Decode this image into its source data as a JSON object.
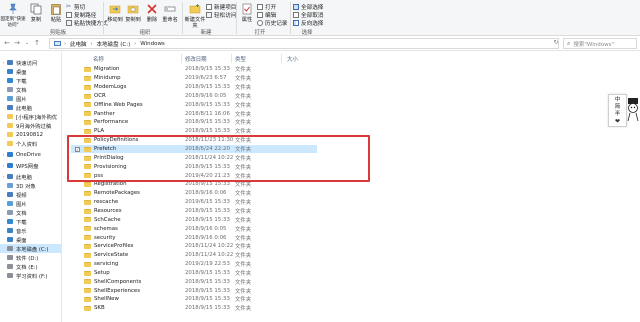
{
  "ribbon": {
    "clipboard": {
      "pin_label": "固定到\"快速访问\"",
      "copy_label": "复制",
      "paste_label": "粘贴",
      "cut_label": "剪切",
      "copy_path_label": "复制路径",
      "paste_shortcut_label": "粘贴快捷方式",
      "group_label": "剪贴板"
    },
    "organize": {
      "move_to_label": "移动到",
      "copy_to_label": "复制到",
      "delete_label": "删除",
      "rename_label": "重命名",
      "group_label": "组织"
    },
    "new": {
      "new_folder_label": "新建文件夹",
      "new_item_label": "新建项目",
      "easy_access_label": "轻松访问",
      "group_label": "新建"
    },
    "open": {
      "properties_label": "属性",
      "open_label": "打开",
      "edit_label": "编辑",
      "history_label": "历史记录",
      "group_label": "打开"
    },
    "select": {
      "select_all_label": "全部选择",
      "select_none_label": "全部取消",
      "invert_label": "反向选择",
      "group_label": "选择"
    }
  },
  "address": {
    "crumbs": [
      "此电脑",
      "本地磁盘 (C:)",
      "Windows"
    ],
    "search_placeholder": "搜索\"Windows\""
  },
  "columns": {
    "name": "名称",
    "date": "修改日期",
    "type": "类型",
    "size": "大小"
  },
  "nav": [
    {
      "label": "快速访问",
      "icon": "star-icon",
      "level": 0
    },
    {
      "label": "桌面",
      "icon": "desktop-icon",
      "level": 1
    },
    {
      "label": "下载",
      "icon": "download-icon",
      "level": 1
    },
    {
      "label": "文档",
      "icon": "document-icon",
      "level": 1
    },
    {
      "label": "图片",
      "icon": "picture-icon",
      "level": 1
    },
    {
      "label": "此电脑",
      "icon": "computer-icon",
      "level": 1
    },
    {
      "label": "[小程序]海外购优",
      "icon": "folder-icon",
      "level": 1
    },
    {
      "label": "9月海外购过稿",
      "icon": "folder-icon",
      "level": 1
    },
    {
      "label": "20190812",
      "icon": "folder-icon",
      "level": 1
    },
    {
      "label": "个人资料",
      "icon": "folder-icon",
      "level": 1
    },
    {
      "label": "OneDrive",
      "icon": "cloud-icon",
      "level": 0
    },
    {
      "label": "WPS网盘",
      "icon": "cloud-icon",
      "level": 0
    },
    {
      "label": "此电脑",
      "icon": "computer-icon",
      "level": 0
    },
    {
      "label": "3D 对象",
      "icon": "cube-icon",
      "level": 1
    },
    {
      "label": "视频",
      "icon": "video-icon",
      "level": 1
    },
    {
      "label": "图片",
      "icon": "picture-icon",
      "level": 1
    },
    {
      "label": "文档",
      "icon": "document-icon",
      "level": 1
    },
    {
      "label": "下载",
      "icon": "download-icon",
      "level": 1
    },
    {
      "label": "音乐",
      "icon": "music-icon",
      "level": 1
    },
    {
      "label": "桌面",
      "icon": "desktop-icon",
      "level": 1
    },
    {
      "label": "本地磁盘 (C:)",
      "icon": "drive-icon",
      "level": 1,
      "selected": true
    },
    {
      "label": "软件 (D:)",
      "icon": "drive-icon",
      "level": 1
    },
    {
      "label": "文档 (E:)",
      "icon": "drive-icon",
      "level": 1
    },
    {
      "label": "学习资料 (F:)",
      "icon": "drive-icon",
      "level": 1
    }
  ],
  "files": [
    {
      "name": "Migration",
      "date": "2018/9/15 15:33",
      "type": "文件夹"
    },
    {
      "name": "Minidump",
      "date": "2019/6/23 6:57",
      "type": "文件夹"
    },
    {
      "name": "ModemLogs",
      "date": "2018/9/15 15:33",
      "type": "文件夹"
    },
    {
      "name": "OCR",
      "date": "2018/9/16 0:05",
      "type": "文件夹"
    },
    {
      "name": "Offline Web Pages",
      "date": "2018/9/15 15:33",
      "type": "文件夹"
    },
    {
      "name": "Panther",
      "date": "2018/8/11 16:06",
      "type": "文件夹"
    },
    {
      "name": "Performance",
      "date": "2018/9/15 15:33",
      "type": "文件夹"
    },
    {
      "name": "PLA",
      "date": "2018/9/15 15:33",
      "type": "文件夹"
    },
    {
      "name": "PolicyDefinitions",
      "date": "2018/11/23 11:30",
      "type": "文件夹"
    },
    {
      "name": "Prefetch",
      "date": "2018/6/24 22:20",
      "type": "文件夹",
      "selected": true
    },
    {
      "name": "PrintDialog",
      "date": "2018/11/24 10:22",
      "type": "文件夹"
    },
    {
      "name": "Provisioning",
      "date": "2018/9/15 15:33",
      "type": "文件夹"
    },
    {
      "name": "pss",
      "date": "2019/4/20 21:23",
      "type": "文件夹"
    },
    {
      "name": "Registration",
      "date": "2018/9/15 15:33",
      "type": "文件夹"
    },
    {
      "name": "RemotePackages",
      "date": "2018/9/16 0:06",
      "type": "文件夹"
    },
    {
      "name": "rescache",
      "date": "2019/6/15 15:33",
      "type": "文件夹"
    },
    {
      "name": "Resources",
      "date": "2018/9/15 15:33",
      "type": "文件夹"
    },
    {
      "name": "SchCache",
      "date": "2018/9/15 15:33",
      "type": "文件夹"
    },
    {
      "name": "schemas",
      "date": "2018/9/16 0:05",
      "type": "文件夹"
    },
    {
      "name": "security",
      "date": "2018/9/16 0:06",
      "type": "文件夹"
    },
    {
      "name": "ServiceProfiles",
      "date": "2018/11/24 10:22",
      "type": "文件夹"
    },
    {
      "name": "ServiceState",
      "date": "2018/11/24 10:22",
      "type": "文件夹"
    },
    {
      "name": "servicing",
      "date": "2019/2/19 22:53",
      "type": "文件夹"
    },
    {
      "name": "Setup",
      "date": "2018/9/15 15:33",
      "type": "文件夹"
    },
    {
      "name": "ShellComponents",
      "date": "2018/9/15 15:33",
      "type": "文件夹"
    },
    {
      "name": "ShellExperiences",
      "date": "2018/9/15 15:33",
      "type": "文件夹"
    },
    {
      "name": "ShellNew",
      "date": "2018/9/15 15:33",
      "type": "文件夹"
    },
    {
      "name": "SKB",
      "date": "2018/9/15 15:33",
      "type": "文件夹"
    }
  ],
  "widget": {
    "line1": "中",
    "line2": "简",
    "line3": "半"
  },
  "colors": {
    "selection": "#cce8ff",
    "highlight_box": "#d9393b",
    "folder": "#f1cb54"
  }
}
